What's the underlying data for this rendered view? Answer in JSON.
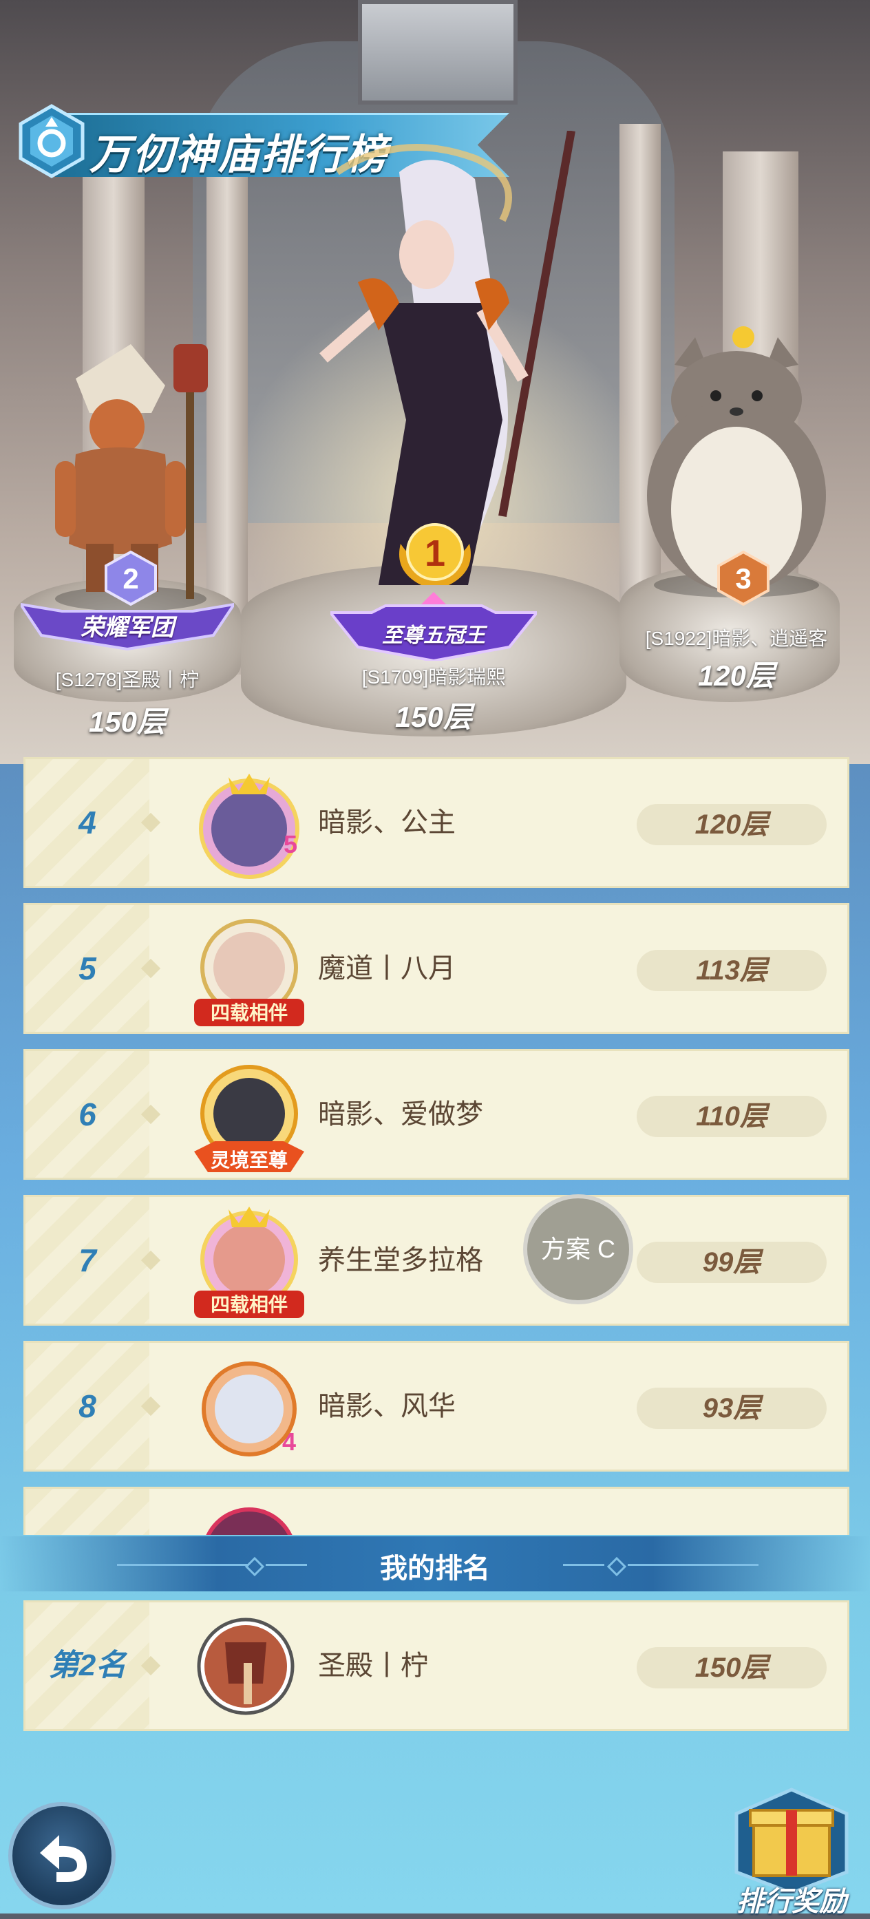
{
  "title": "万仞神庙排行榜",
  "podium": [
    {
      "rank": "2",
      "badge": "荣耀军团",
      "name": "[S1278]圣殿丨柠",
      "floors": "150层"
    },
    {
      "rank": "1",
      "badge": "至尊五冠王",
      "name": "[S1709]暗影瑞熙",
      "floors": "150层"
    },
    {
      "rank": "3",
      "badge": "",
      "name": "[S1922]暗影、逍遥客",
      "floors": "120层"
    }
  ],
  "list": [
    {
      "rank": "4",
      "name": "暗影、公主",
      "floors": "120层",
      "avatar_tag": "5"
    },
    {
      "rank": "5",
      "name": "魔道丨八月",
      "floors": "113层",
      "avatar_tag": "四载相伴"
    },
    {
      "rank": "6",
      "name": "暗影、爱做梦",
      "floors": "110层",
      "avatar_tag": "灵境至尊"
    },
    {
      "rank": "7",
      "name": "养生堂多拉格",
      "floors": "99层",
      "avatar_tag": "四载相伴"
    },
    {
      "rank": "8",
      "name": "暗影、风华",
      "floors": "93层",
      "avatar_tag": "4"
    }
  ],
  "my_rank": {
    "title": "我的排名",
    "rank": "第2名",
    "name": "圣殿丨柠",
    "floors": "150层"
  },
  "floating_button": "方案 C",
  "reward_button": "排行奖励",
  "colors": {
    "accent": "#2f7fb6",
    "row_bg": "#f6f3dd",
    "text_brown": "#5b4634"
  }
}
